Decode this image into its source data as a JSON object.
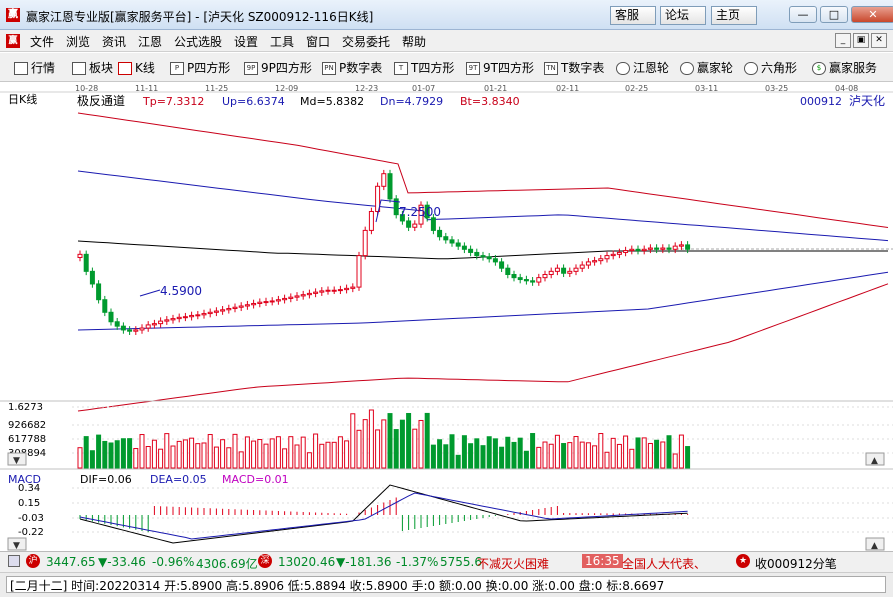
{
  "window": {
    "title": "赢家江恩专业版[赢家服务平台] - [泸天化  SZ000912-116日K线]",
    "service_btn": "客服",
    "forum_btn": "论坛",
    "home_btn": "主页",
    "app_icon": "赢"
  },
  "menu": {
    "items": [
      "文件",
      "浏览",
      "资讯",
      "江恩",
      "公式选股",
      "设置",
      "工具",
      "窗口",
      "交易委托",
      "帮助"
    ]
  },
  "toolbar": {
    "items": [
      {
        "label": "行情",
        "icon": "grid-icon"
      },
      {
        "label": "板块",
        "icon": "sector-icon"
      },
      {
        "label": "K线",
        "icon": "candle-icon"
      },
      {
        "label": "P四方形",
        "icon": "P"
      },
      {
        "label": "9P四方形",
        "icon": "9P"
      },
      {
        "label": "P数字表",
        "icon": "PN"
      },
      {
        "label": "T四方形",
        "icon": "T"
      },
      {
        "label": "9T四方形",
        "icon": "9T"
      },
      {
        "label": "T数字表",
        "icon": "TN"
      },
      {
        "label": "江恩轮",
        "icon": "wheel-icon"
      },
      {
        "label": "赢家轮",
        "icon": "wheel-icon"
      },
      {
        "label": "六角形",
        "icon": "hexagon-icon"
      },
      {
        "label": "赢家服务",
        "icon": "dollar-icon"
      }
    ]
  },
  "chart": {
    "x_dates": [
      "10-28",
      "11-11",
      "11-25",
      "12-09",
      "12-23",
      "01-07",
      "01-21",
      "02-11",
      "02-25",
      "03-11",
      "03-25",
      "04-08"
    ],
    "left_corner_label": "日K线",
    "indicator_name": "极反通道",
    "tp": "Tp=7.3312",
    "up": "Up=6.6374",
    "md": "Md=5.8382",
    "dn": "Dn=4.7929",
    "bt": "Bt=3.8340",
    "stock_code": "000912",
    "stock_name": "泸天化",
    "high_label": "7.2500",
    "low_label": "4.5900",
    "volume_axis": [
      "1.6273",
      "926682",
      "617788",
      "308894"
    ],
    "macd": {
      "name": "MACD",
      "dif": "DIF=0.06",
      "dea": "DEA=0.05",
      "macd": "MACD=0.01",
      "axis": [
        "0.34",
        "0.15",
        "-0.03",
        "-0.22"
      ]
    }
  },
  "chart_data": {
    "type": "candlestick",
    "title": "泸天化 000912 日K线",
    "indicator": "极反通道",
    "indicator_values": {
      "Tp": 7.3312,
      "Up": 6.6374,
      "Md": 5.8382,
      "Dn": 4.7929,
      "Bt": 3.834
    },
    "visible_high": 7.25,
    "visible_low": 4.59,
    "close_series": [
      5.82,
      5.55,
      5.35,
      5.1,
      4.9,
      4.75,
      4.68,
      4.62,
      4.6,
      4.62,
      4.65,
      4.7,
      4.72,
      4.76,
      4.78,
      4.8,
      4.82,
      4.83,
      4.85,
      4.86,
      4.88,
      4.9,
      4.92,
      4.94,
      4.96,
      4.98,
      5.0,
      5.02,
      5.04,
      5.06,
      5.07,
      5.08,
      5.1,
      5.12,
      5.14,
      5.16,
      5.18,
      5.2,
      5.22,
      5.24,
      5.25,
      5.25,
      5.26,
      5.28,
      5.3,
      5.8,
      6.2,
      6.5,
      6.9,
      7.1,
      6.7,
      6.45,
      6.35,
      6.25,
      6.3,
      6.6,
      6.4,
      6.2,
      6.1,
      6.05,
      6.0,
      5.95,
      5.9,
      5.85,
      5.8,
      5.78,
      5.75,
      5.7,
      5.6,
      5.5,
      5.45,
      5.42,
      5.4,
      5.38,
      5.45,
      5.5,
      5.55,
      5.6,
      5.52,
      5.55,
      5.6,
      5.65,
      5.7,
      5.72,
      5.75,
      5.8,
      5.82,
      5.85,
      5.88,
      5.9,
      5.88,
      5.9,
      5.92,
      5.9,
      5.92,
      5.9,
      5.95,
      5.97,
      5.9
    ],
    "volume_max": 1627300,
    "macd_latest": {
      "DIF": 0.06,
      "DEA": 0.05,
      "MACD": 0.01
    },
    "macd_range": [
      -0.22,
      0.34
    ]
  },
  "status": {
    "sh_index": "3447.65",
    "sh_change": "▼-33.46",
    "sh_pct": "-0.96%",
    "sh_amount": "4306.69亿",
    "sz_index": "13020.46",
    "sz_change": "▼-181.36",
    "sz_pct": "-1.37%",
    "sz_amount": "5755.6",
    "news_left": "不减灭火困难",
    "news_time": "16:35",
    "news_right": "全国人大代表、",
    "fav": "收000912分笔"
  },
  "bottom": {
    "info": "[二月十二] 时间:20220314 开:5.8900 高:5.8906 低:5.8894 收:5.8900 手:0 额:0.00 换:0.00 涨:0.00 盘:0 标:8.6697"
  },
  "colors": {
    "up": "#e0001b",
    "down": "#009a2e",
    "channel_outer": "#c8001a",
    "channel_inner": "#1a1ab0",
    "mid": "#000000"
  }
}
